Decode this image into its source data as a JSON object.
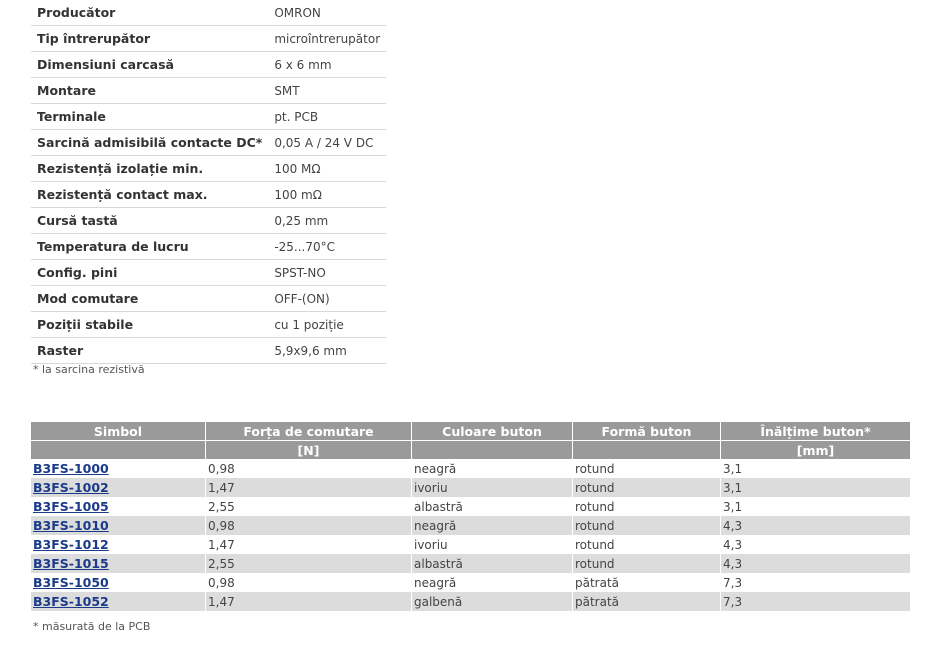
{
  "specs": [
    {
      "label": "Producător",
      "value": "OMRON"
    },
    {
      "label": "Tip întrerupător",
      "value": "microîntrerupător"
    },
    {
      "label": "Dimensiuni carcasă",
      "value": "6 x 6 mm"
    },
    {
      "label": "Montare",
      "value": "SMT"
    },
    {
      "label": "Terminale",
      "value": "pt. PCB"
    },
    {
      "label": "Sarcină admisibilă contacte DC*",
      "value": "0,05 A / 24 V DC"
    },
    {
      "label": "Rezistență izolație min.",
      "value": "100 MΩ"
    },
    {
      "label": "Rezistență contact max.",
      "value": "100 mΩ"
    },
    {
      "label": "Cursă tastă",
      "value": "0,25 mm"
    },
    {
      "label": "Temperatura de lucru",
      "value": "-25...70°C"
    },
    {
      "label": "Config. pini",
      "value": "SPST-NO"
    },
    {
      "label": "Mod comutare",
      "value": "OFF-(ON)"
    },
    {
      "label": "Poziții stabile",
      "value": "cu 1 poziție"
    },
    {
      "label": "Raster",
      "value": "5,9x9,6 mm"
    }
  ],
  "specs_note": "* la sarcina rezistivă",
  "products": {
    "headers": [
      "Simbol",
      "Forța de comutare",
      "Culoare buton",
      "Formă buton",
      "Înălțime buton*"
    ],
    "units": [
      "",
      "[N]",
      "",
      "",
      "[mm]"
    ],
    "rows": [
      {
        "symbol": "B3FS-1000",
        "force": "0,98",
        "color": "neagră",
        "shape": "rotund",
        "height": "3,1"
      },
      {
        "symbol": "B3FS-1002",
        "force": "1,47",
        "color": "ivoriu",
        "shape": "rotund",
        "height": "3,1"
      },
      {
        "symbol": "B3FS-1005",
        "force": "2,55",
        "color": "albastră",
        "shape": "rotund",
        "height": "3,1"
      },
      {
        "symbol": "B3FS-1010",
        "force": "0,98",
        "color": "neagră",
        "shape": "rotund",
        "height": "4,3"
      },
      {
        "symbol": "B3FS-1012",
        "force": "1,47",
        "color": "ivoriu",
        "shape": "rotund",
        "height": "4,3"
      },
      {
        "symbol": "B3FS-1015",
        "force": "2,55",
        "color": "albastră",
        "shape": "rotund",
        "height": "4,3"
      },
      {
        "symbol": "B3FS-1050",
        "force": "0,98",
        "color": "neagră",
        "shape": "pătrată",
        "height": "7,3"
      },
      {
        "symbol": "B3FS-1052",
        "force": "1,47",
        "color": "galbenă",
        "shape": "pătrată",
        "height": "7,3"
      }
    ]
  },
  "products_note": "* măsurată de la PCB"
}
